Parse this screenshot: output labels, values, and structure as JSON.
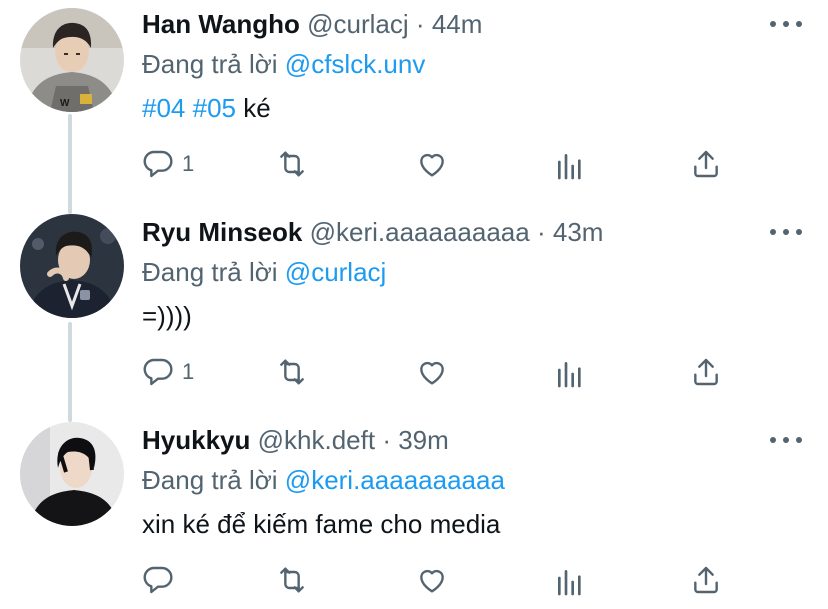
{
  "colors": {
    "link": "#1d9bf0",
    "muted": "#536471",
    "text": "#0f1419",
    "thread": "#cfd9de"
  },
  "tweets": [
    {
      "name": "Han Wangho",
      "handle": "@curlacj",
      "separator": "·",
      "time": "44m",
      "reply_prefix": "Đang trả lời",
      "reply_to": "@cfslck.unv",
      "hashtag1": "#04",
      "hashtag2": "#05",
      "text": "ké",
      "reply_count": "1",
      "icons": [
        "reply-icon",
        "retweet-icon",
        "like-icon",
        "analytics-icon",
        "share-icon"
      ]
    },
    {
      "name": "Ryu Minseok",
      "handle": "@keri.aaaaaaaaaa",
      "separator": "·",
      "time": "43m",
      "reply_prefix": "Đang trả lời",
      "reply_to": "@curlacj",
      "text": "=))))",
      "reply_count": "1",
      "icons": [
        "reply-icon",
        "retweet-icon",
        "like-icon",
        "analytics-icon",
        "share-icon"
      ]
    },
    {
      "name": "Hyukkyu",
      "handle": "@khk.deft",
      "separator": "·",
      "time": "39m",
      "reply_prefix": "Đang trả lời",
      "reply_to": "@keri.aaaaaaaaaa",
      "text": "xin ké để kiếm fame cho media",
      "reply_count": "",
      "icons": [
        "reply-icon",
        "retweet-icon",
        "like-icon",
        "analytics-icon",
        "share-icon"
      ]
    }
  ]
}
